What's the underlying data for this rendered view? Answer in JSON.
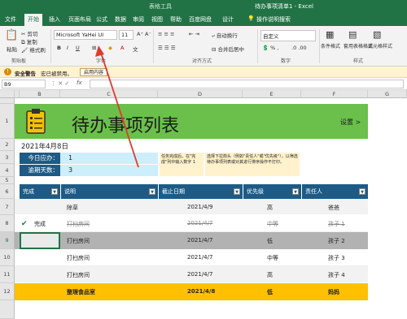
{
  "window": {
    "tools_label": "表格工具",
    "doc_title": "待办事项清单1 - Excel"
  },
  "tabs": [
    "文件",
    "开始",
    "插入",
    "页面布局",
    "公式",
    "数据",
    "审阅",
    "视图",
    "帮助",
    "百度网盘",
    "设计"
  ],
  "tell_me": "操作说明搜索",
  "ribbon": {
    "paste": "粘贴",
    "cut": "剪切",
    "copy": "复制",
    "format_painter": "格式刷",
    "font_name": "Microsoft YaHei UI",
    "font_size": "11",
    "bold": "B",
    "italic": "I",
    "underline": "U",
    "wrap": "自动换行",
    "merge": "合并后居中",
    "number_format": "自定义",
    "cond_format": "条件格式",
    "table_format": "套用表格格式",
    "cell_style": "单元格样式",
    "groups": {
      "clipboard": "剪贴板",
      "font": "字体",
      "align": "对齐方式",
      "number": "数字",
      "styles": "样式"
    }
  },
  "security": {
    "label": "安全警告",
    "text": "宏已被禁用。",
    "button": "启用内容"
  },
  "formula_bar": {
    "name_box": "B9",
    "fx": "fx"
  },
  "columns": [
    "A",
    "B",
    "C",
    "D",
    "E",
    "F",
    "G"
  ],
  "rows": [
    "1",
    "2",
    "3",
    "4",
    "5",
    "6",
    "7",
    "8",
    "9",
    "10",
    "11",
    "12"
  ],
  "sheet": {
    "title": "待办事项列表",
    "settings": "设置 >",
    "date": "2021年4月8日",
    "due_today_label": "今日应办：",
    "due_today": "1",
    "overdue_label": "逾期天数：",
    "overdue": "3",
    "note1": "任务完成后，在\"完成\"列中输入数字 1",
    "note2": "选择下拉箭头（例如\"责任人\"或\"优先级\"），以筛选待办事项列表或对其进行排序操作不打印。"
  },
  "table": {
    "headers": [
      "完成",
      "说明",
      "截止日期",
      "优先级",
      "责任人"
    ],
    "rows": [
      {
        "done": "",
        "desc": "除草",
        "date": "2021/4/9",
        "priority": "高",
        "owner": "爸爸"
      },
      {
        "done": "完成",
        "desc": "打扫房间",
        "date": "2021/4/7",
        "priority": "中等",
        "owner": "孩子 1"
      },
      {
        "done": "",
        "desc": "打扫房间",
        "date": "2021/4/7",
        "priority": "低",
        "owner": "孩子 2"
      },
      {
        "done": "",
        "desc": "打扫房间",
        "date": "2021/4/7",
        "priority": "中等",
        "owner": "孩子 3"
      },
      {
        "done": "",
        "desc": "打扫房间",
        "date": "2021/4/7",
        "priority": "高",
        "owner": "孩子 4"
      },
      {
        "done": "",
        "desc": "整理食品室",
        "date": "2021/4/8",
        "priority": "低",
        "owner": "妈妈"
      }
    ]
  },
  "colors": {
    "excel_green": "#217346",
    "banner": "#6bc04b",
    "header": "#1d5b86",
    "highlight": "#ffc000",
    "overdue": "#b2b2b2",
    "note": "#fff2cc",
    "info": "#cdeefb"
  }
}
